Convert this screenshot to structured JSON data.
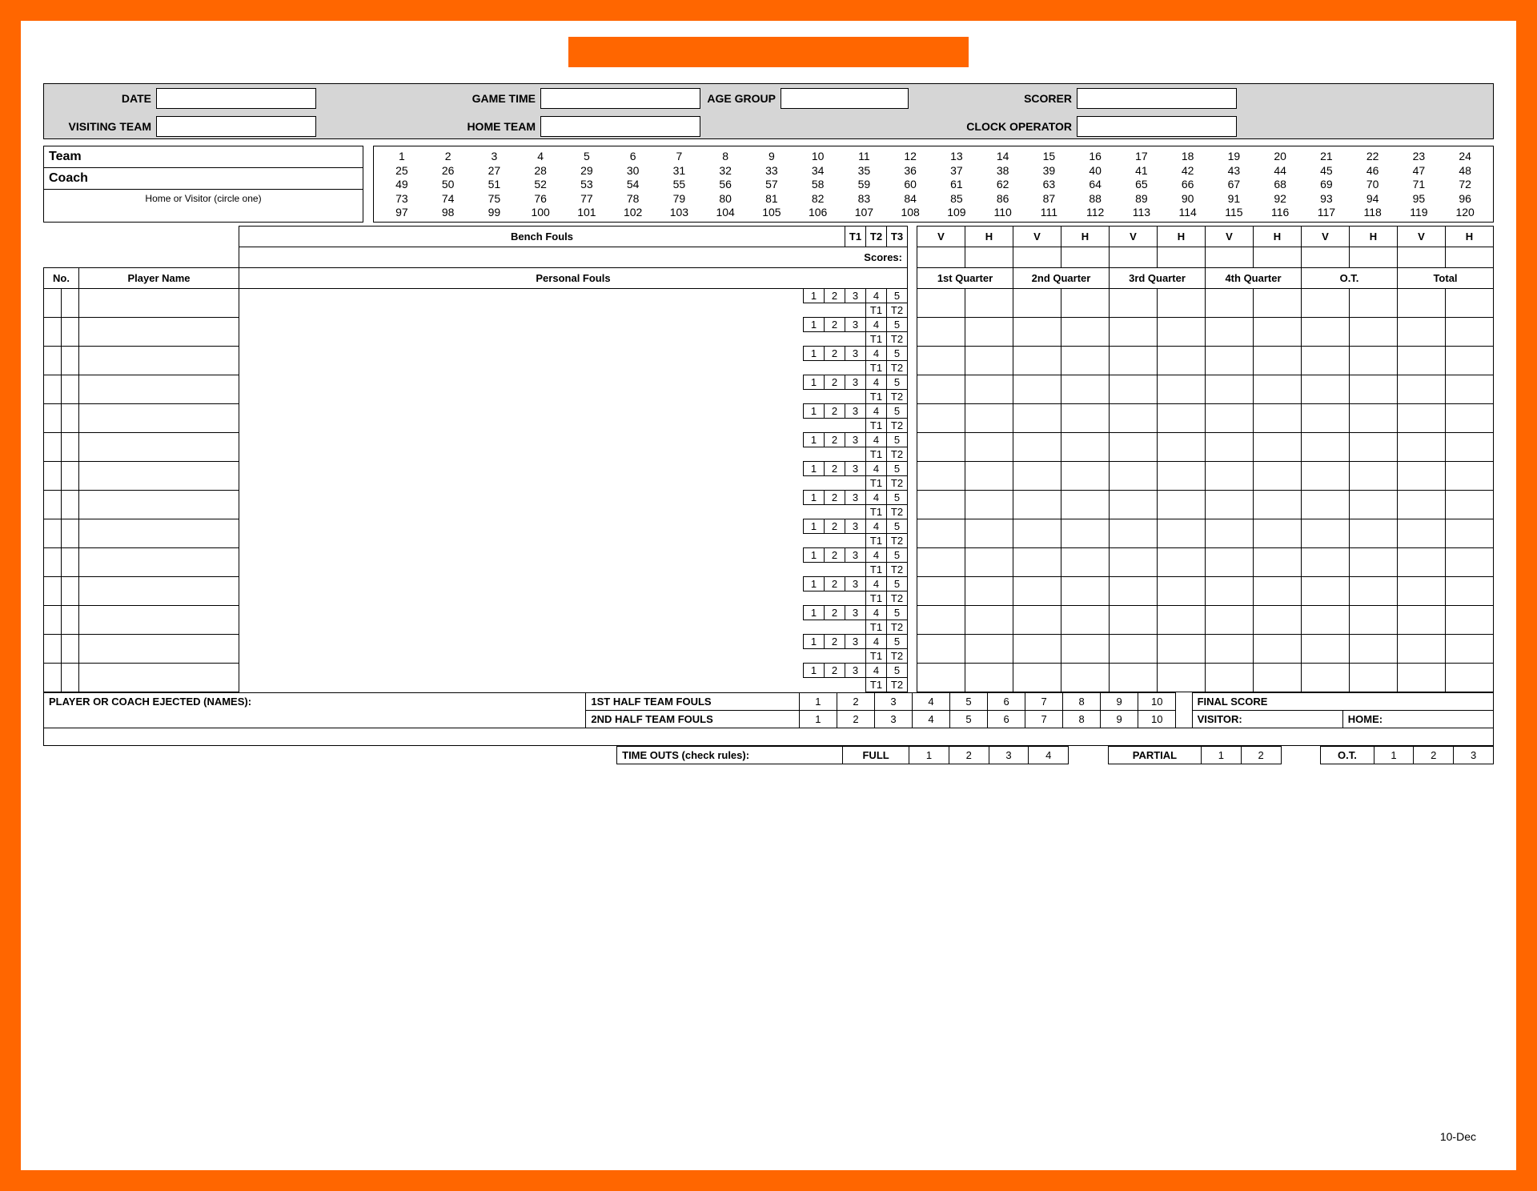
{
  "info": {
    "date_label": "DATE",
    "game_time_label": "GAME TIME",
    "age_group_label": "AGE GROUP",
    "scorer_label": "SCORER",
    "visiting_team_label": "VISITING TEAM",
    "home_team_label": "HOME TEAM",
    "clock_operator_label": "CLOCK OPERATOR"
  },
  "team_box": {
    "team": "Team",
    "coach": "Coach",
    "circle": "Home or Visitor (circle one)"
  },
  "score_numbers": {
    "rows": [
      [
        "1",
        "2",
        "3",
        "4",
        "5",
        "6",
        "7",
        "8",
        "9",
        "10",
        "11",
        "12",
        "13",
        "14",
        "15",
        "16",
        "17",
        "18",
        "19",
        "20",
        "21",
        "22",
        "23",
        "24"
      ],
      [
        "25",
        "26",
        "27",
        "28",
        "29",
        "30",
        "31",
        "32",
        "33",
        "34",
        "35",
        "36",
        "37",
        "38",
        "39",
        "40",
        "41",
        "42",
        "43",
        "44",
        "45",
        "46",
        "47",
        "48"
      ],
      [
        "49",
        "50",
        "51",
        "52",
        "53",
        "54",
        "55",
        "56",
        "57",
        "58",
        "59",
        "60",
        "61",
        "62",
        "63",
        "64",
        "65",
        "66",
        "67",
        "68",
        "69",
        "70",
        "71",
        "72"
      ],
      [
        "73",
        "74",
        "75",
        "76",
        "77",
        "78",
        "79",
        "80",
        "81",
        "82",
        "83",
        "84",
        "85",
        "86",
        "87",
        "88",
        "89",
        "90",
        "91",
        "92",
        "93",
        "94",
        "95",
        "96"
      ],
      [
        "97",
        "98",
        "99",
        "100",
        "101",
        "102",
        "103",
        "104",
        "105",
        "106",
        "107",
        "108",
        "109",
        "110",
        "111",
        "112",
        "113",
        "114",
        "115",
        "116",
        "117",
        "118",
        "119",
        "120"
      ]
    ]
  },
  "headers": {
    "bench_fouls": "Bench Fouls",
    "t1": "T1",
    "t2": "T2",
    "t3": "T3",
    "scores": "Scores:",
    "v": "V",
    "h": "H",
    "no": "No.",
    "player_name": "Player Name",
    "personal_fouls": "Personal Fouls",
    "quarters": [
      "1st Quarter",
      "2nd Quarter",
      "3rd Quarter",
      "4th Quarter",
      "O.T.",
      "Total"
    ]
  },
  "foul_cells": {
    "nums": [
      "1",
      "2",
      "3",
      "4",
      "5"
    ],
    "t_small": [
      "T1",
      "T2"
    ]
  },
  "bottom": {
    "ejected": "PLAYER OR COACH EJECTED (NAMES):",
    "half1": "1ST HALF TEAM FOULS",
    "half2": "2ND HALF TEAM FOULS",
    "fouls10": [
      "1",
      "2",
      "3",
      "4",
      "5",
      "6",
      "7",
      "8",
      "9",
      "10"
    ],
    "timeouts": "TIME OUTS (check rules):",
    "full": "FULL",
    "full_nums": [
      "1",
      "2",
      "3",
      "4"
    ],
    "partial": "PARTIAL",
    "partial_nums": [
      "1",
      "2"
    ],
    "ot": "O.T.",
    "ot_nums": [
      "1",
      "2",
      "3"
    ],
    "final_score": "FINAL SCORE",
    "visitor": "VISITOR:",
    "home": "HOME:"
  },
  "footer_date": "10-Dec"
}
